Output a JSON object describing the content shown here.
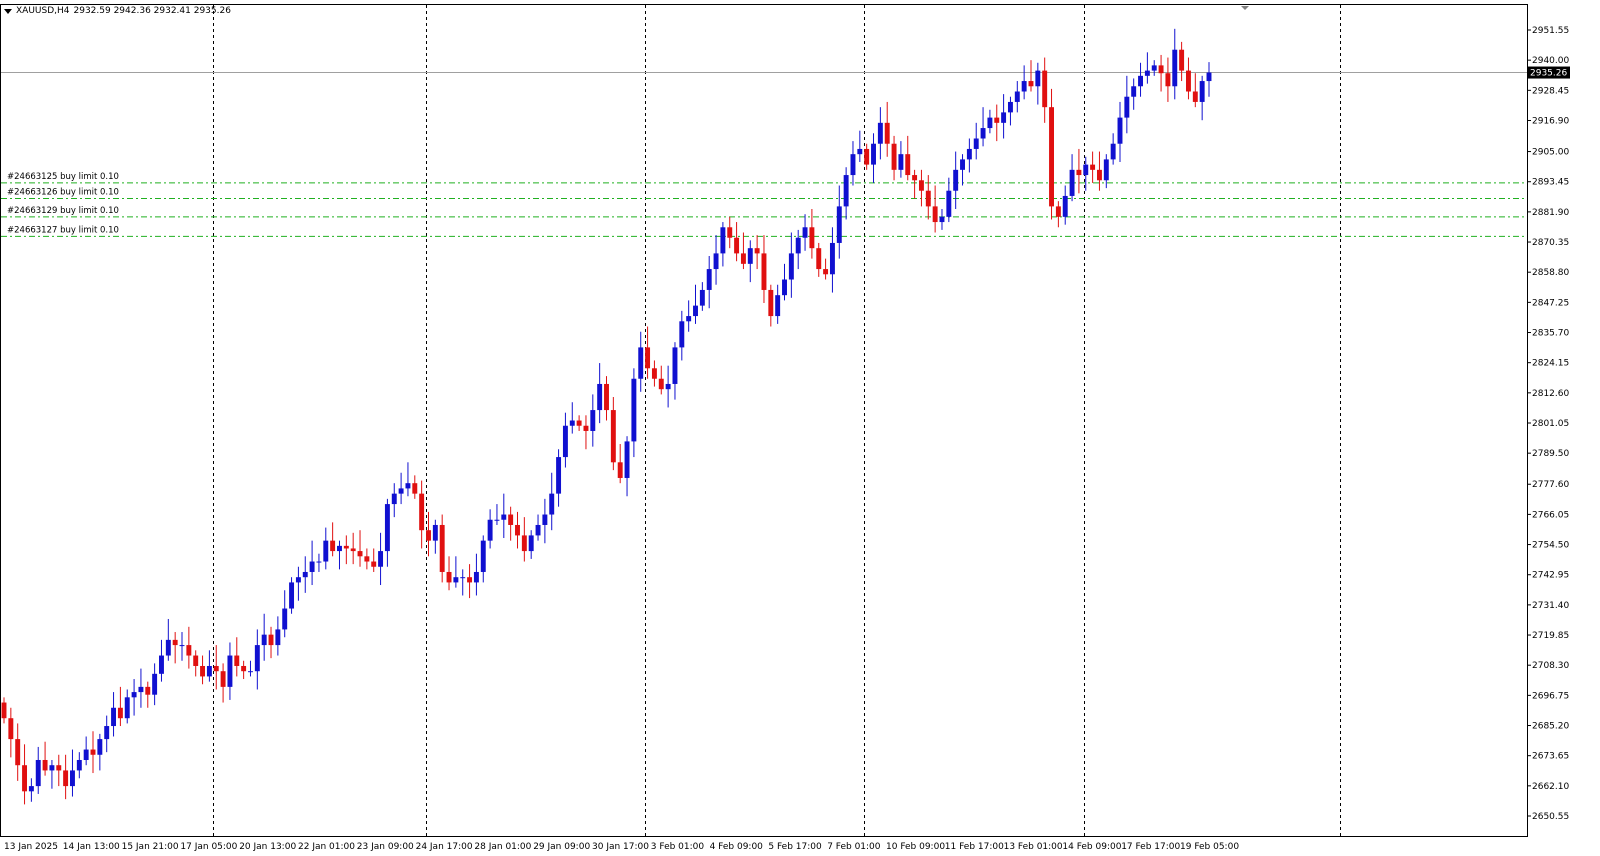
{
  "header": {
    "symbol": "XAUUSD,H4",
    "ohlc": "2932.59 2942.36 2932.41 2935.26"
  },
  "colors": {
    "bull": "#1010d0",
    "bear": "#e01010",
    "order_line": "#20b020",
    "price_line": "#a0a0a0",
    "grid": "#000000"
  },
  "current_price": {
    "value": 2935.26,
    "label": "2935.26"
  },
  "orders": [
    {
      "label": "#24663125 buy limit 0.10",
      "price": 2893.0
    },
    {
      "label": "#24663126 buy limit 0.10",
      "price": 2887.0
    },
    {
      "label": "#24663129 buy limit 0.10",
      "price": 2880.0
    },
    {
      "label": "#24663127 buy limit 0.10",
      "price": 2872.5
    }
  ],
  "chart_data": {
    "type": "candlestick",
    "symbol": "XAUUSD",
    "timeframe": "H4",
    "ylim": [
      2650.5,
      2960
    ],
    "y_ticks": [
      "2951.55",
      "2940.00",
      "2928.45",
      "2916.90",
      "2905.00",
      "2893.45",
      "2881.90",
      "2870.35",
      "2858.80",
      "2847.25",
      "2835.70",
      "2824.15",
      "2812.60",
      "2801.05",
      "2789.50",
      "2777.60",
      "2766.05",
      "2754.50",
      "2742.95",
      "2731.40",
      "2719.85",
      "2708.30",
      "2696.75",
      "2685.20",
      "2673.65",
      "2662.10",
      "2650.55"
    ],
    "x_ticks": [
      "13 Jan 2025",
      "14 Jan 13:00",
      "15 Jan 21:00",
      "17 Jan 05:00",
      "20 Jan 13:00",
      "22 Jan 01:00",
      "23 Jan 09:00",
      "24 Jan 17:00",
      "28 Jan 01:00",
      "29 Jan 09:00",
      "30 Jan 17:00",
      "3 Feb 01:00",
      "4 Feb 09:00",
      "5 Feb 17:00",
      "7 Feb 01:00",
      "10 Feb 09:00",
      "11 Feb 17:00",
      "13 Feb 01:00",
      "14 Feb 09:00",
      "17 Feb 17:00",
      "19 Feb 05:00"
    ],
    "closes": [
      2688,
      2680,
      2670,
      2660,
      2662,
      2672,
      2668,
      2670,
      2668,
      2662,
      2668,
      2672,
      2676,
      2674,
      2680,
      2685,
      2692,
      2688,
      2696,
      2698,
      2700,
      2697,
      2705,
      2712,
      2718,
      2716,
      2716,
      2712,
      2708,
      2704,
      2708,
      2706,
      2700,
      2712,
      2708,
      2706,
      2706,
      2716,
      2720,
      2716,
      2722,
      2730,
      2740,
      2742,
      2744,
      2748,
      2748,
      2756,
      2752,
      2754,
      2753,
      2752,
      2750,
      2748,
      2746,
      2752,
      2770,
      2774,
      2776,
      2778,
      2774,
      2760,
      2756,
      2762,
      2744,
      2740,
      2742,
      2742,
      2740,
      2744,
      2756,
      2764,
      2764,
      2766,
      2762,
      2758,
      2752,
      2758,
      2762,
      2766,
      2774,
      2788,
      2800,
      2802,
      2800,
      2798,
      2806,
      2816,
      2806,
      2786,
      2780,
      2794,
      2818,
      2830,
      2822,
      2818,
      2814,
      2816,
      2830,
      2840,
      2842,
      2846,
      2852,
      2860,
      2866,
      2876,
      2872,
      2866,
      2862,
      2868,
      2866,
      2852,
      2842,
      2850,
      2856,
      2866,
      2872,
      2876,
      2868,
      2860,
      2858,
      2870,
      2884,
      2896,
      2904,
      2906,
      2900,
      2908,
      2916,
      2908,
      2898,
      2904,
      2896,
      2894,
      2890,
      2884,
      2878,
      2880,
      2890,
      2898,
      2902,
      2906,
      2910,
      2914,
      2918,
      2916,
      2920,
      2924,
      2928,
      2932,
      2930,
      2936,
      2922,
      2884,
      2880,
      2888,
      2898,
      2896,
      2900,
      2898,
      2894,
      2902,
      2908,
      2918,
      2926,
      2930,
      2934,
      2936,
      2938,
      2935,
      2930,
      2944,
      2936,
      2928,
      2924,
      2932,
      2935.26
    ]
  }
}
